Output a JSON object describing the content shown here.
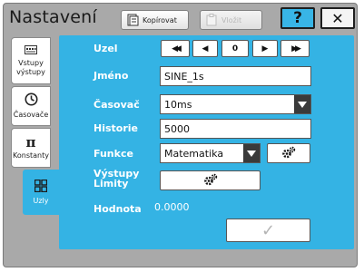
{
  "header": {
    "title": "Nastavení",
    "copy_label": "Kopírovat",
    "paste_label": "Vložit",
    "help_label": "?",
    "close_label": "✕"
  },
  "sidebar": {
    "items": [
      {
        "label": "Vstupy výstupy",
        "icon": "io-panel-icon"
      },
      {
        "label": "Časovače",
        "icon": "clock-icon"
      },
      {
        "label": "Konstanty",
        "icon": "pi-icon",
        "glyph": "π"
      },
      {
        "label": "Uzly",
        "icon": "nodes-icon"
      }
    ],
    "active": "Uzly"
  },
  "form": {
    "node_label": "Uzel",
    "node_nav": {
      "first": "◀◀",
      "prev": "◀",
      "value": "0",
      "next": "▶",
      "last": "▶▶"
    },
    "name_label": "Jméno",
    "name_value": "SINE_1s",
    "timer_label": "Časovač",
    "timer_value": "10ms",
    "history_label": "Historie",
    "history_value": "5000",
    "function_label": "Funkce",
    "function_value": "Matematika",
    "outputs_label": "Výstupy\nLimity",
    "outputs_line1": "Výstupy",
    "outputs_line2": "Limity",
    "value_label": "Hodnota",
    "value_value": "0.0000",
    "confirm_glyph": "✓"
  },
  "colors": {
    "accent": "#34b3e4",
    "frame": "#a9a9a9",
    "dark": "#3a3a3a"
  }
}
